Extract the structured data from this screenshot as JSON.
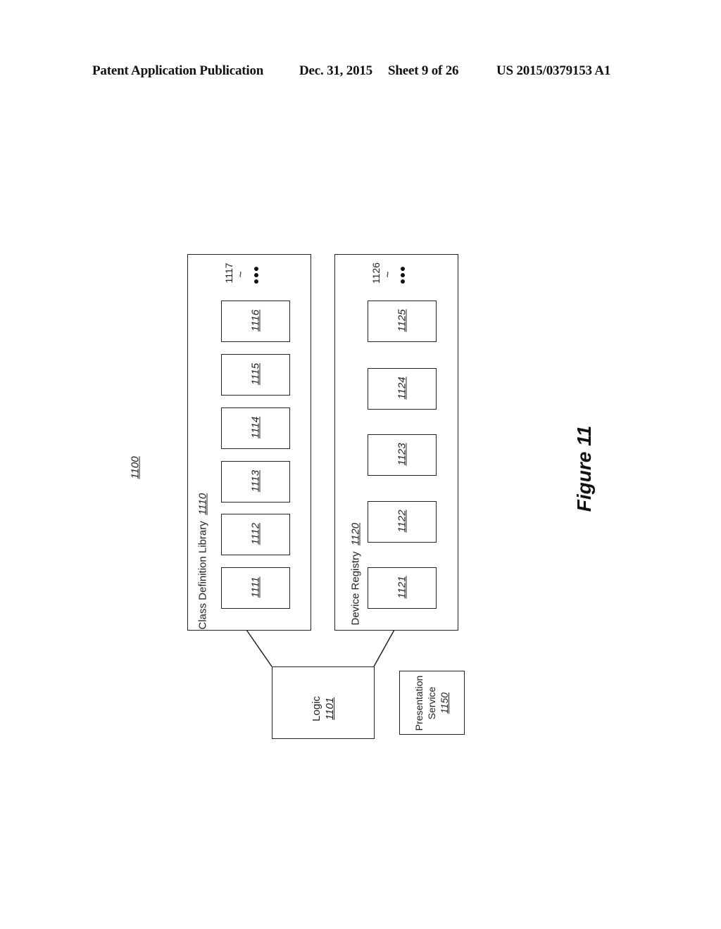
{
  "header": {
    "publication": "Patent Application Publication",
    "date": "Dec. 31, 2015",
    "sheet": "Sheet 9 of 26",
    "number": "US 2015/0379153 A1"
  },
  "figure": {
    "ref": "1100",
    "caption": "Figure 11"
  },
  "class_library": {
    "label": "Class Definition Library",
    "ref": "1110",
    "items": [
      "1111",
      "1112",
      "1113",
      "1114",
      "1115",
      "1116"
    ],
    "more_ref": "1117"
  },
  "device_registry": {
    "label": "Device Registry",
    "ref": "1120",
    "items": [
      "1121",
      "1122",
      "1123",
      "1124",
      "1125"
    ],
    "more_ref": "1126"
  },
  "logic": {
    "label": "Logic",
    "ref": "1101"
  },
  "presentation": {
    "label_line1": "Presentation",
    "label_line2": "Service",
    "ref": "1150"
  }
}
